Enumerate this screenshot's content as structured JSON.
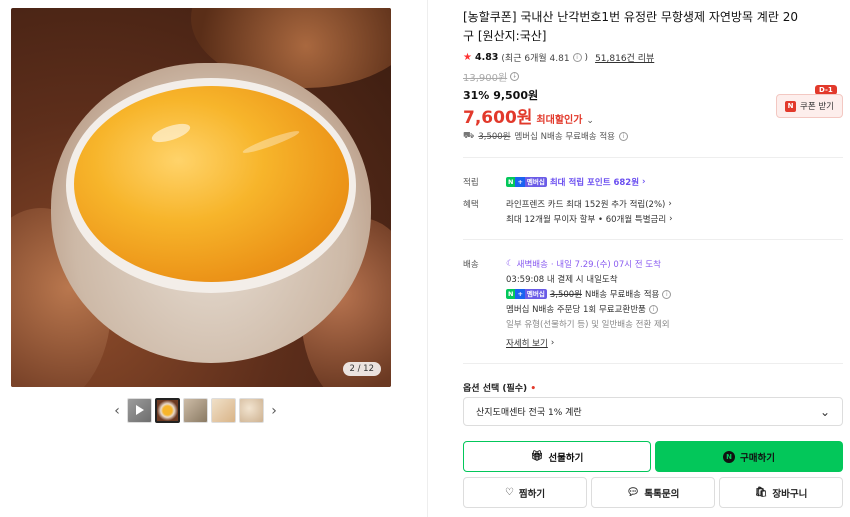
{
  "gallery": {
    "counter": "2 / 12",
    "prev_icon": "chevron-left-icon",
    "next_icon": "chevron-right-icon",
    "thumbnails": [
      "video-thumb",
      "egg-yolk-thumb",
      "package-thumb",
      "eggs-thumb",
      "egg-tray-thumb"
    ]
  },
  "product": {
    "title": "[농할쿠폰] 국내산 난각번호1번 유정란 무항생제 자연방목 계란 20구 [원산지:국산]",
    "rating": "4.83",
    "rating_recent": "(최근 6개월 4.81",
    "rating_recent_close": ")",
    "review_count": "51,816건 리뷰",
    "original_price": "13,900원",
    "discount_pct": "31%",
    "discount_price": "9,500원",
    "max_discount_price": "7,600원",
    "max_discount_label": "최대할인가",
    "coupon_badge": "D-1",
    "coupon_label": "쿠폰 받기",
    "shipping_strike": "3,500원",
    "shipping_text": "멤버십 N배송 무료배송 적용"
  },
  "benefits": {
    "points_label": "적립",
    "membership_tag": "멤버십",
    "points_text": "최대 적립 포인트 682원",
    "perks_label": "혜택",
    "perk1": "라인프렌즈 카드 최대 152원 추가 적립(2%)",
    "perk2": "최대 12개월 무이자 할부 • 60개월 특별금리"
  },
  "delivery": {
    "label": "배송",
    "method": "새벽배송",
    "eta": "· 내일 7.29.(수) 07시 전 도착",
    "cutoff": "03:59:08 내 결제 시 내일도착",
    "membership_tag": "멤버십",
    "fee_strike": "3,500원",
    "fee_text": "N배송 무료배송 적용",
    "return_text": "멤버십 N배송 주문당 1회 무료교환반품",
    "exclusion_text": "일부 유형(선물하기 등) 및 일반배송 전환 제외",
    "more_link": "자세히 보기"
  },
  "options": {
    "label": "옵션 선택 (필수)",
    "required_dot": "•",
    "selected": "산지도매센타 전국 1% 계란"
  },
  "actions": {
    "gift": "선물하기",
    "buy": "구매하기",
    "zzim": "찜하기",
    "talk": "톡톡문의",
    "cart": "장바구니"
  },
  "colors": {
    "accent_green": "#03c75a",
    "price_red": "#e2392b",
    "membership_purple": "#6b4ff0"
  }
}
